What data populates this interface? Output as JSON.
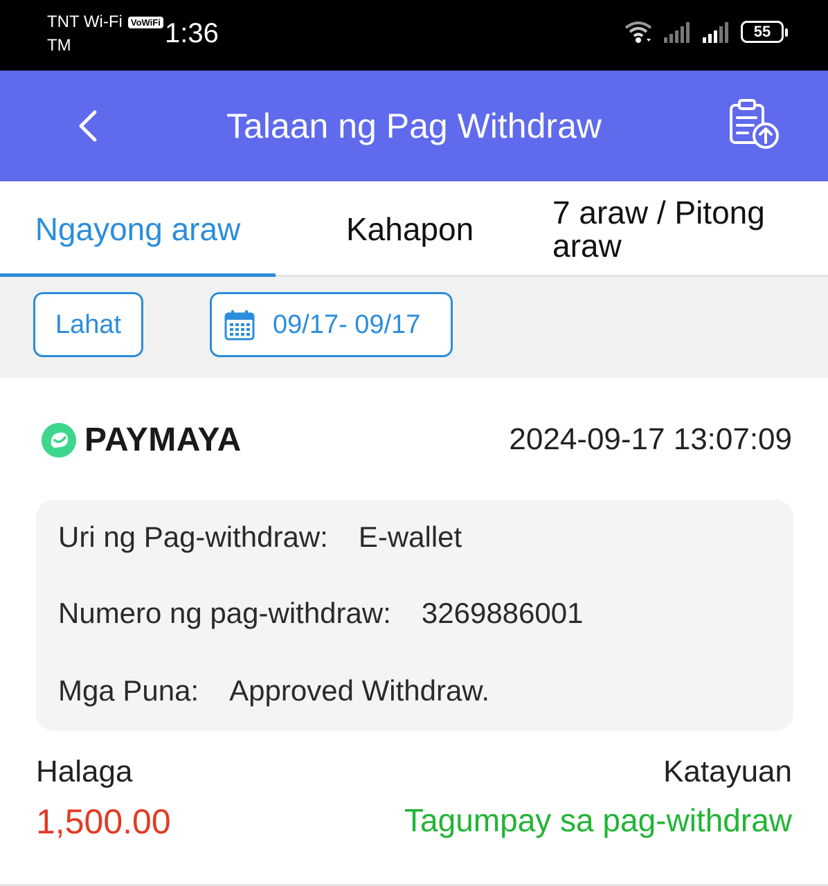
{
  "status_bar": {
    "carrier": "TNT Wi-Fi",
    "vowifi": "VoWiFi",
    "carrier2": "TM",
    "time": "1:36",
    "battery": "55"
  },
  "header": {
    "title": "Talaan ng Pag Withdraw"
  },
  "tabs": [
    {
      "label": "Ngayong araw",
      "active": true
    },
    {
      "label": "Kahapon",
      "active": false
    },
    {
      "label": "7 araw / Pitong araw",
      "active": false
    }
  ],
  "filters": {
    "all_label": "Lahat",
    "date_range": "09/17- 09/17"
  },
  "record": {
    "provider": "PAYMAYA",
    "datetime": "2024-09-17 13:07:09",
    "details": [
      {
        "label": "Uri ng Pag-withdraw:",
        "value": "E-wallet"
      },
      {
        "label": "Numero ng pag-withdraw:",
        "value": "3269886001"
      },
      {
        "label": "Mga Puna:",
        "value": "Approved Withdraw."
      }
    ],
    "amount_label": "Halaga",
    "amount": "1,500.00",
    "status_label": "Katayuan",
    "status": "Tagumpay sa pag-withdraw"
  },
  "colors": {
    "header_bg": "#5f6aec",
    "accent_blue": "#2b8ddb",
    "amount_red": "#e23a24",
    "success_green": "#21b534",
    "paymaya_green": "#3dd68c"
  }
}
